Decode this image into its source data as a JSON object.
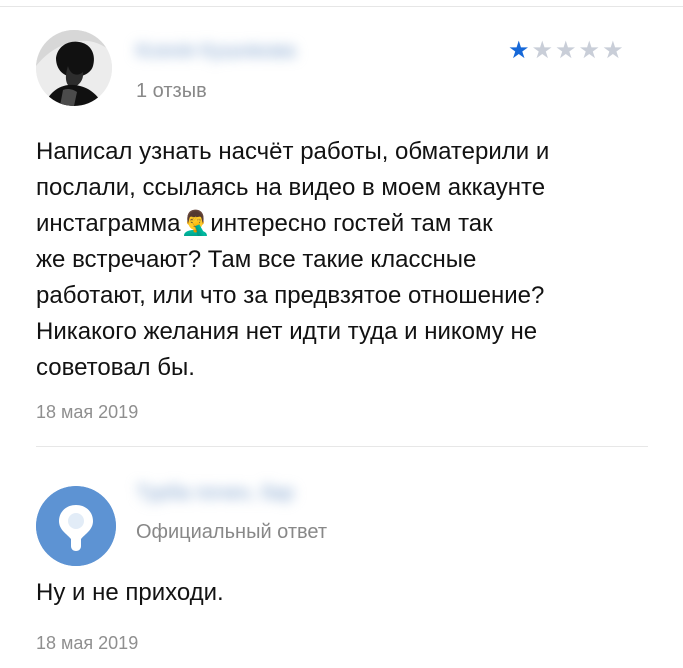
{
  "theme": {
    "star_active": "#1668d8",
    "star_inactive": "#c9ced8",
    "brand_avatar": "#5d93d3",
    "muted_text": "#888888"
  },
  "reviews": [
    {
      "author_name": "Ксенія Кушнікова",
      "meta": "1 отзыв",
      "rating": 1,
      "max_rating": 5,
      "text": "Написал узнать насчёт работы, обматерили и\nпослали, ссылаясь на видео в моем аккаунте\nинстаграмма🤦‍♂️интересно гостей там так\nже встречают? Там все такие классные\nработают, или что за предвзятое отношение?\nНикакого желания нет идти туда и никому не\nсоветовал бы.",
      "date": "18 мая 2019",
      "avatar_icon": "user-photo-avatar"
    },
    {
      "author_name": "Турба почен, бар",
      "meta": "Официальный ответ",
      "text": "Ну и не приходи.",
      "date": "18 мая 2019",
      "avatar_icon": "location-pin-avatar"
    }
  ]
}
